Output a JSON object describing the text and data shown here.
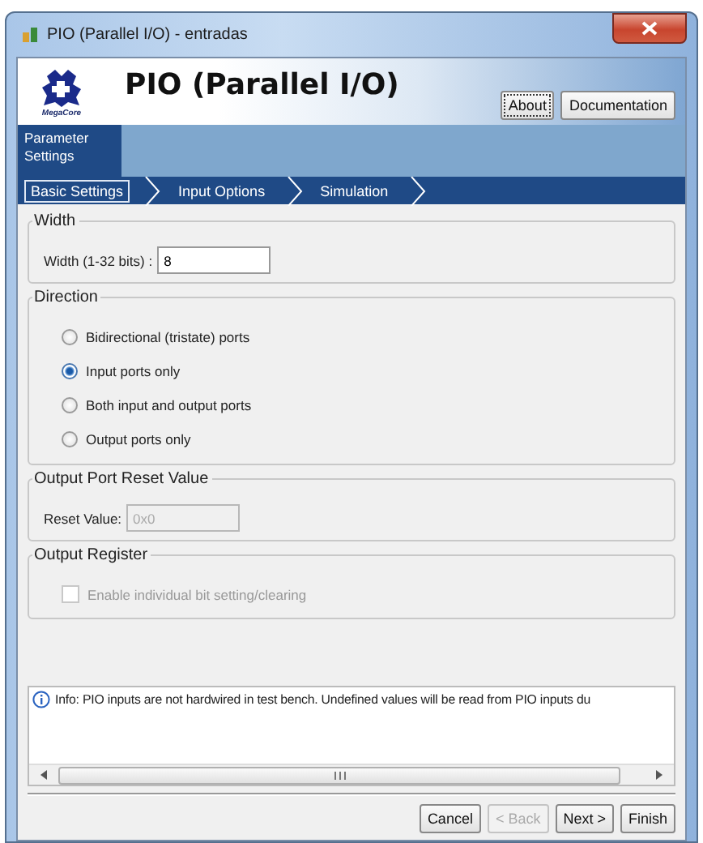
{
  "window": {
    "title": "PIO (Parallel I/O) - entradas"
  },
  "header": {
    "logo_caption": "MegaCore",
    "title": "PIO (Parallel I/O)",
    "buttons": [
      {
        "label": "About",
        "focused": true
      },
      {
        "label": "Documentation",
        "focused": false
      }
    ]
  },
  "page_tabs": [
    {
      "label": "Parameter Settings",
      "selected": true
    }
  ],
  "steps": [
    {
      "label": "Basic Settings",
      "selected": true
    },
    {
      "label": "Input Options",
      "selected": false
    },
    {
      "label": "Simulation",
      "selected": false
    }
  ],
  "groups": [
    {
      "kind": "field",
      "title": "Width",
      "label": "Width (1-32 bits) :",
      "value": "8",
      "disabled": false
    },
    {
      "kind": "radios",
      "title": "Direction",
      "options": [
        {
          "label": "Bidirectional (tristate) ports",
          "selected": false
        },
        {
          "label": "Input ports only",
          "selected": true
        },
        {
          "label": "Both input and output ports",
          "selected": false
        },
        {
          "label": "Output ports only",
          "selected": false
        }
      ]
    },
    {
      "kind": "field",
      "title": "Output Port Reset Value",
      "label": "Reset Value:",
      "value": "0x0",
      "disabled": true
    },
    {
      "kind": "checkbox",
      "title": "Output Register",
      "label": "Enable individual bit setting/clearing",
      "checked": false,
      "disabled": true
    }
  ],
  "info": {
    "text": "Info: PIO inputs are not hardwired in test bench. Undefined values will be read from PIO inputs du"
  },
  "buttons": [
    {
      "label": "Cancel",
      "disabled": false
    },
    {
      "label": "< Back",
      "disabled": true
    },
    {
      "label": "Next >",
      "disabled": false
    },
    {
      "label": "Finish",
      "disabled": false
    }
  ]
}
